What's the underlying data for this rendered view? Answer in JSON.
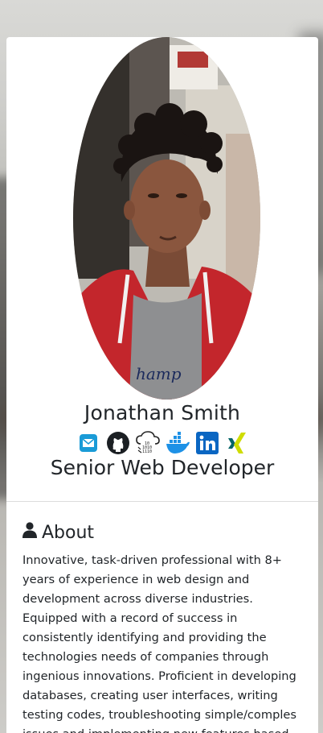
{
  "profile": {
    "name": "Jonathan Smith",
    "role": "Senior Web Developer",
    "photo_alt": "profile-photo"
  },
  "social": [
    {
      "icon": "email-icon"
    },
    {
      "icon": "github-icon"
    },
    {
      "icon": "cloud-binary-icon"
    },
    {
      "icon": "docker-icon"
    },
    {
      "icon": "linkedin-icon"
    },
    {
      "icon": "xing-icon"
    }
  ],
  "about": {
    "heading": "About",
    "text": "Innovative, task-driven professional with 8+ years of experience in web design and development across diverse industries. Equipped with a record of success in consistently identifying and providing the technologies needs of companies through ingenious innovations. Proficient in developing databases, creating user interfaces, writing testing codes, troubleshooting simple/comples issues and implementing new features based on"
  },
  "colors": {
    "email": "#1a9bd7",
    "docker": "#1d91e6",
    "linkedin": "#0a66c2",
    "xing_dark": "#026466",
    "xing_light": "#cfdc00"
  }
}
